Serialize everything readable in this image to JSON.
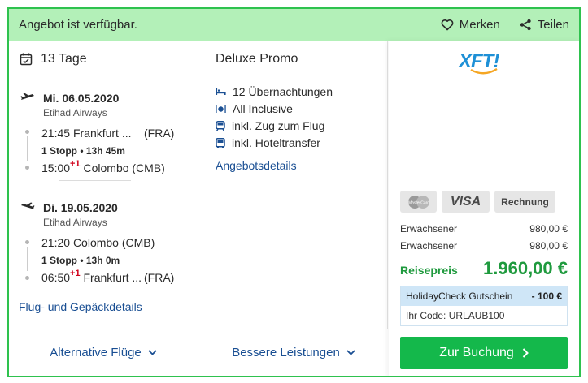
{
  "topbar": {
    "availability": "Angebot ist verfügbar.",
    "save_label": "Merken",
    "share_label": "Teilen"
  },
  "flights": {
    "duration": "13 Tage",
    "outbound": {
      "date": "Mi. 06.05.2020",
      "airline": "Etihad Airways",
      "dep_time": "21:45",
      "dep_city": "Frankfurt ...",
      "dep_code": "(FRA)",
      "stops": "1 Stopp",
      "travel_time": "13h 45m",
      "arr_time": "15:00",
      "day_offset": "+1",
      "arr_city": "Colombo (CMB)"
    },
    "inbound": {
      "date": "Di. 19.05.2020",
      "airline": "Etihad Airways",
      "dep_time": "21:20",
      "dep_city": "Colombo (CMB)",
      "stops": "1 Stopp",
      "travel_time": "13h 0m",
      "arr_time": "06:50",
      "day_offset": "+1",
      "arr_city": "Frankfurt ...",
      "arr_code": "(FRA)"
    },
    "details_link": "Flug- und Gepäckdetails",
    "alt_flights_label": "Alternative Flüge"
  },
  "offer": {
    "title": "Deluxe Promo",
    "features": [
      {
        "icon": "bed-icon",
        "label": "12 Übernachtungen"
      },
      {
        "icon": "dining-icon",
        "label": "All Inclusive"
      },
      {
        "icon": "train-icon",
        "label": "inkl. Zug zum Flug"
      },
      {
        "icon": "bus-icon",
        "label": "inkl. Hoteltransfer"
      }
    ],
    "details_link": "Angebotsdetails",
    "better_services_label": "Bessere Leistungen"
  },
  "booking": {
    "operator_logo": "XFT!",
    "payment": {
      "mastercard": "MasterCard",
      "visa": "VISA",
      "invoice": "Rechnung"
    },
    "travelers": [
      {
        "label": "Erwachsener",
        "price": "980,00 €"
      },
      {
        "label": "Erwachsener",
        "price": "980,00 €"
      }
    ],
    "total_label": "Reisepreis",
    "total_price": "1.960,00 €",
    "voucher_title": "HolidayCheck Gutschein",
    "voucher_amount": "- 100 €",
    "voucher_code": "Ihr Code: URLAUB100",
    "book_label": "Zur Buchung"
  },
  "colors": {
    "accent_green": "#14b84b",
    "price_green": "#1f9a3e",
    "link_blue": "#1a4f93",
    "topbar_bg": "#b3f0b8",
    "red": "#d0021b"
  }
}
